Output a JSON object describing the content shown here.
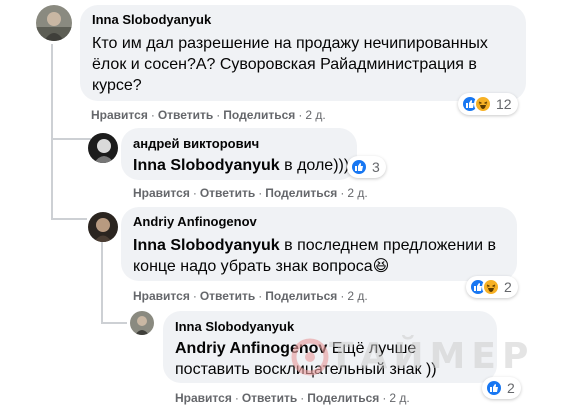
{
  "colors": {
    "bubble_bg": "#f0f2f5",
    "action_text": "#65676b",
    "like_blue": "#1877f2",
    "haha_yellow": "#f7b125",
    "watermark_red": "#e8a0a0"
  },
  "comments": [
    {
      "author": "Inna Slobodyanyuk",
      "text": "Кто им дал разрешение на продажу нечипированных ёлок и сосен?А? Суворовская Райадминистрация в курсе?",
      "mention": "",
      "reactions": {
        "icons": [
          "like-icon",
          "haha-icon"
        ],
        "count": "12"
      },
      "actions": {
        "like": "Нравится",
        "reply": "Ответить",
        "share": "Поделиться",
        "time": "2 д."
      }
    },
    {
      "author": "андрей викторович",
      "mention": "Inna Slobodyanyuk",
      "text": " в доле)))",
      "reactions": {
        "icons": [
          "like-icon"
        ],
        "count": "3"
      },
      "actions": {
        "like": "Нравится",
        "reply": "Ответить",
        "share": "Поделиться",
        "time": "2 д."
      }
    },
    {
      "author": "Andriy Anfinogenov",
      "mention": "Inna Slobodyanyuk",
      "text": " в последнем предложении в конце надо убрать знак вопроса",
      "emoji": "😆",
      "reactions": {
        "icons": [
          "like-icon",
          "haha-icon"
        ],
        "count": "2"
      },
      "actions": {
        "like": "Нравится",
        "reply": "Ответить",
        "share": "Поделиться",
        "time": "2 д."
      }
    },
    {
      "author": "Inna Slobodyanyuk",
      "mention": "Andriy Anfinogenov",
      "text": " Ещё лучше поставить восклицательный знак ))",
      "reactions": {
        "icons": [
          "like-icon"
        ],
        "count": "2"
      },
      "actions": {
        "like": "Нравится",
        "reply": "Ответить",
        "share": "Поделиться",
        "time": "2 д."
      }
    }
  ],
  "separator": "·",
  "watermark": {
    "text": "ТАЙМЕР"
  }
}
